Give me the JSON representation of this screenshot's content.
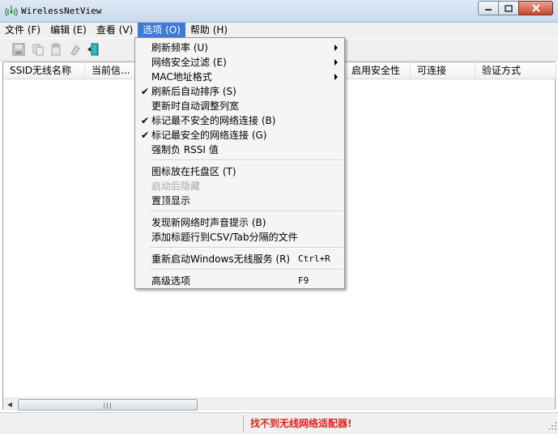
{
  "window": {
    "title": "WirelessNetView"
  },
  "menubar": {
    "items": [
      {
        "label": "文件 (F)"
      },
      {
        "label": "编辑 (E)"
      },
      {
        "label": "查看 (V)"
      },
      {
        "label": "选项 (O)"
      },
      {
        "label": "帮助 (H)"
      }
    ]
  },
  "columns": [
    "SSID无线名称",
    "当前信...",
    "启用安全性",
    "可连接",
    "验证方式"
  ],
  "options_menu": {
    "items": [
      {
        "label": "刷新频率 (U)",
        "checked": false,
        "submenu": true,
        "shortcut": "",
        "disabled": false
      },
      {
        "label": "网络安全过滤 (E)",
        "checked": false,
        "submenu": true,
        "shortcut": "",
        "disabled": false
      },
      {
        "label": "MAC地址格式",
        "checked": false,
        "submenu": true,
        "shortcut": "",
        "disabled": false
      },
      {
        "label": "刷新后自动排序 (S)",
        "checked": true,
        "submenu": false,
        "shortcut": "",
        "disabled": false
      },
      {
        "label": "更新时自动调整列宽",
        "checked": false,
        "submenu": false,
        "shortcut": "",
        "disabled": false
      },
      {
        "label": "标记最不安全的网络连接 (B)",
        "checked": true,
        "submenu": false,
        "shortcut": "",
        "disabled": false
      },
      {
        "label": "标记最安全的网络连接 (G)",
        "checked": true,
        "submenu": false,
        "shortcut": "",
        "disabled": false
      },
      {
        "label": "强制负 RSSI 值",
        "checked": false,
        "submenu": false,
        "shortcut": "",
        "disabled": false
      },
      {
        "label": "图标放在托盘区 (T)",
        "checked": false,
        "submenu": false,
        "shortcut": "",
        "disabled": false
      },
      {
        "label": "启动后隐藏",
        "checked": false,
        "submenu": false,
        "shortcut": "",
        "disabled": true
      },
      {
        "label": "置顶显示",
        "checked": false,
        "submenu": false,
        "shortcut": "",
        "disabled": false
      },
      {
        "label": "发现新网络时声音提示 (B)",
        "checked": false,
        "submenu": false,
        "shortcut": "",
        "disabled": false
      },
      {
        "label": "添加标题行到CSV/Tab分隔的文件",
        "checked": false,
        "submenu": false,
        "shortcut": "",
        "disabled": false
      },
      {
        "label": "重新启动Windows无线服务 (R)",
        "checked": false,
        "submenu": false,
        "shortcut": "Ctrl+R",
        "disabled": false
      },
      {
        "label": "高级选项",
        "checked": false,
        "submenu": false,
        "shortcut": "F9",
        "disabled": false
      }
    ],
    "check_mark": "✔"
  },
  "statusbar": {
    "message": "找不到无线网络适配器!"
  },
  "scrollbar": {
    "thumb_grip": "|||"
  },
  "colors": {
    "menu_highlight": "#3d7bd4",
    "status_error": "#e0201a",
    "toolbar_exit_icon": "#1aa0a8"
  }
}
